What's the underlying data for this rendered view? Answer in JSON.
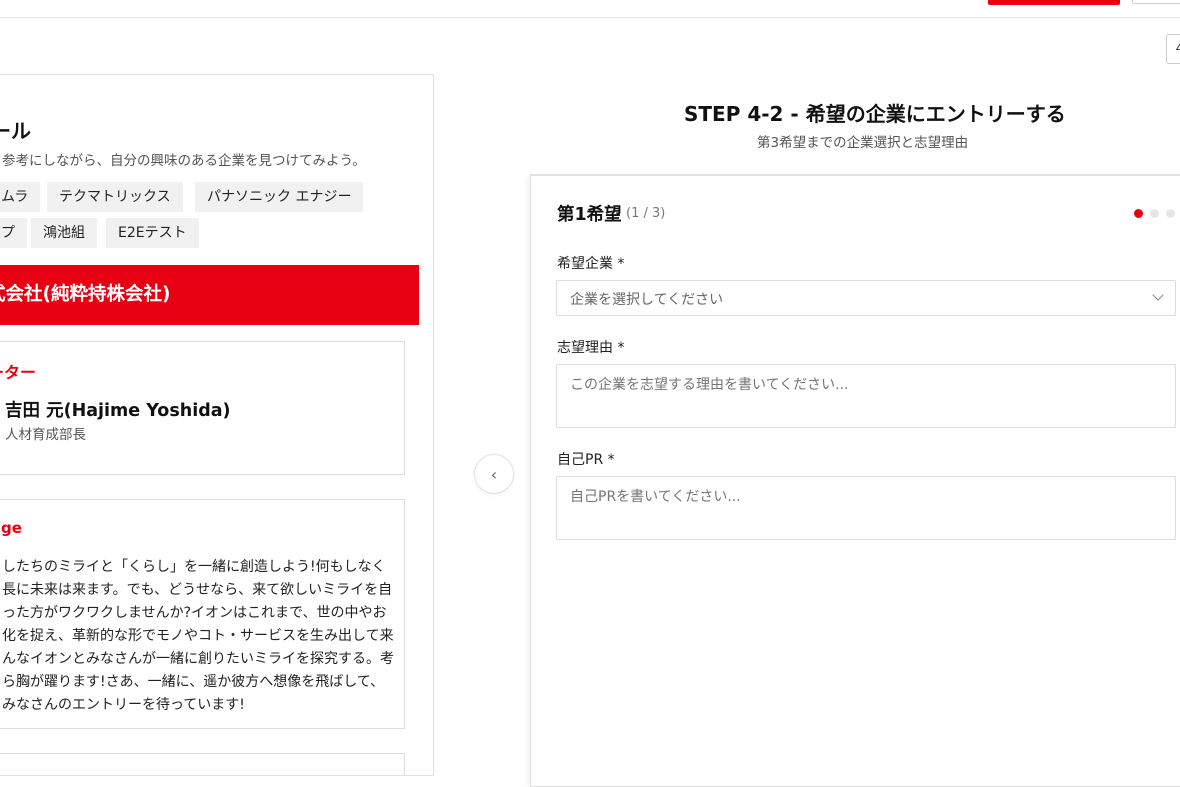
{
  "left_panel": {
    "title": "ール",
    "description": "参考にしながら、自分の興味のある企業を見つけてみよう。",
    "chips": [
      "ムラ",
      "テクマトリックス",
      "パナソニック エナジー",
      "プ",
      "鴻池組",
      "E2Eテスト"
    ],
    "company_banner": "式会社(純粋持株会社)",
    "recruiter": {
      "label": "ーター",
      "name": "吉田 元(Hajime Yoshida)",
      "role": "人材育成部長"
    },
    "message": {
      "label": "ge",
      "lines": [
        "したちのミライと「くらし」を一緒に創造しよう!何もしなく",
        "長に未来は来ます。でも、どうせなら、来て欲しいミライを自",
        "った方がワクワクしませんか?イオンはこれまで、世の中やお",
        "化を捉え、革新的な形でモノやコト・サービスを生み出して来",
        "んなイオンとみなさんが一緒に創りたいミライを探究する。考",
        "ら胸が躍ります!さあ、一緒に、遥か彼方へ想像を飛ばして、",
        "みなさんのエントリーを待っています!"
      ]
    }
  },
  "nav": {
    "prev_arrow": "‹",
    "corner_button": "∠"
  },
  "step": {
    "heading": "STEP 4-2 - 希望の企業にエントリーする",
    "subheading": "第3希望までの企業選択と志望理由"
  },
  "form": {
    "choice_title": "第1希望",
    "choice_count": "(1 / 3)",
    "pagination_active": 1,
    "pagination_total": 3,
    "company_label": "希望企業 *",
    "company_placeholder": "企業を選択してください",
    "reason_label": "志望理由 *",
    "reason_placeholder": "この企業を志望する理由を書いてください...",
    "pr_label": "自己PR *",
    "pr_placeholder": "自己PRを書いてください..."
  },
  "colors": {
    "accent": "#e60012",
    "border": "#dddddd",
    "chip_bg": "#f1f1f1"
  }
}
